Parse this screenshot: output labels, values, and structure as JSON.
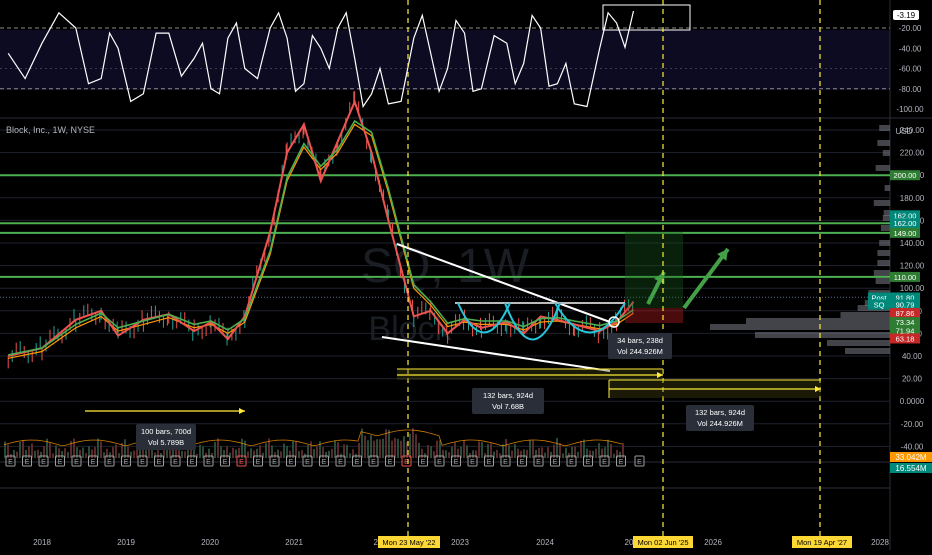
{
  "header": {
    "symbol_line": "Block, Inc., 1W, NYSE",
    "currency": "USD"
  },
  "watermark": {
    "ticker": "SQ, 1W",
    "name": "Block"
  },
  "colors": {
    "up": "#26a69a",
    "down": "#ef5350",
    "green_line": "#4caf50",
    "grid": "#1e222d",
    "text": "#b2b5be",
    "yellow": "#ffeb3b",
    "ema_fast": "#ef5350",
    "ema_slow": "#ff9800",
    "ema_green": "#4caf50",
    "cup": "#26c6da",
    "tag_green": "#2e7d32",
    "tag_teal": "#00897b",
    "tag_red": "#c62828"
  },
  "oscillator": {
    "current_label": "-3.19",
    "ticks": [
      "-20.00",
      "-40.00",
      "-60.00",
      "-80.00",
      "-100.00"
    ],
    "tick_values": [
      -20,
      -40,
      -60,
      -80,
      -100
    ]
  },
  "price_axis": {
    "ticks": [
      "240.00",
      "220.00",
      "200.00",
      "180.00",
      "160.00",
      "140.00",
      "120.00",
      "100.00",
      "80.00",
      "60.00",
      "40.00",
      "20.00",
      "0.0000",
      "-20.00",
      "-40.00"
    ],
    "tick_values": [
      240,
      220,
      200,
      180,
      160,
      140,
      120,
      100,
      80,
      60,
      40,
      20,
      0,
      -20,
      -40
    ]
  },
  "price_tags": [
    {
      "text": "200.00",
      "value": 200,
      "color": "tag_green"
    },
    {
      "text": "162.00",
      "value": 164.5,
      "color": "tag_teal"
    },
    {
      "text": "162.00",
      "value": 157.5,
      "color": "tag_teal"
    },
    {
      "text": "149.00",
      "value": 149,
      "color": "tag_green"
    },
    {
      "text": "110.00",
      "value": 110,
      "color": "tag_green"
    },
    {
      "text": "91.80",
      "value": 91.8,
      "color": "tag_teal",
      "prefix": "Post"
    },
    {
      "text": "90.79",
      "value": 85.5,
      "color": "tag_teal",
      "prefix": "SQ"
    },
    {
      "text": "87.86",
      "value": 78,
      "color": "tag_red"
    },
    {
      "text": "73.34",
      "value": 70,
      "color": "tag_green"
    },
    {
      "text": "71.94",
      "value": 62.5,
      "color": "tag_green"
    },
    {
      "text": "63.18",
      "value": 55.5,
      "color": "tag_red"
    }
  ],
  "volume_tags": [
    "33.042M",
    "16.554M"
  ],
  "horizontal_levels": [
    200,
    162,
    149,
    110
  ],
  "time_axis": {
    "years": [
      "2018",
      "2019",
      "2020",
      "2021",
      "20",
      "2023",
      "2024",
      "20",
      "2026",
      "2028"
    ],
    "highlights": [
      "Mon 23 May '22",
      "Mon 02 Jun '25",
      "Mon 19 Apr '27"
    ]
  },
  "measurements": [
    {
      "line1": "100 bars, 700d",
      "line2": "Vol 5.789B"
    },
    {
      "line1": "132 bars, 924d",
      "line2": "Vol 7.68B"
    },
    {
      "line1": "34 bars, 238d",
      "line2": "Vol 244.926M"
    },
    {
      "line1": "132 bars, 924d",
      "line2": "Vol 244.926M"
    }
  ],
  "events_marker": "E",
  "chart_data": {
    "type": "line",
    "title": "Block, Inc., 1W, NYSE",
    "x": [
      2017.6,
      2018.0,
      2018.4,
      2018.7,
      2018.9,
      2019.2,
      2019.5,
      2019.8,
      2020.0,
      2020.2,
      2020.4,
      2020.7,
      2020.9,
      2021.1,
      2021.3,
      2021.5,
      2021.7,
      2021.9,
      2022.1,
      2022.4,
      2022.6,
      2022.8,
      2023.0,
      2023.2,
      2023.5,
      2023.7,
      2023.9,
      2024.1,
      2024.3,
      2024.6,
      2024.8,
      2025.0
    ],
    "ylim": [
      -50,
      260
    ],
    "series": [
      {
        "values": [
          40,
          47,
          72,
          80,
          58,
          72,
          77,
          62,
          70,
          55,
          75,
          150,
          220,
          245,
          195,
          230,
          265,
          220,
          160,
          75,
          80,
          60,
          72,
          65,
          70,
          60,
          75,
          72,
          68,
          62,
          70,
          88
        ]
      },
      {
        "values": [
          38,
          44,
          65,
          75,
          62,
          68,
          74,
          65,
          68,
          60,
          70,
          130,
          195,
          225,
          205,
          220,
          245,
          235,
          185,
          100,
          85,
          66,
          70,
          68,
          68,
          63,
          70,
          71,
          68,
          64,
          68,
          78
        ]
      }
    ],
    "oscillator_values": [
      -45,
      -35,
      -20,
      -70,
      -40,
      -85,
      -25,
      -50,
      -80,
      -30,
      -60,
      -20,
      -30,
      -75,
      -40,
      -20,
      -50,
      -85,
      -95,
      -30,
      -45,
      -60,
      -25,
      -80,
      -35,
      -55,
      -20,
      -75,
      -95,
      -40,
      -15,
      -3.19
    ]
  }
}
